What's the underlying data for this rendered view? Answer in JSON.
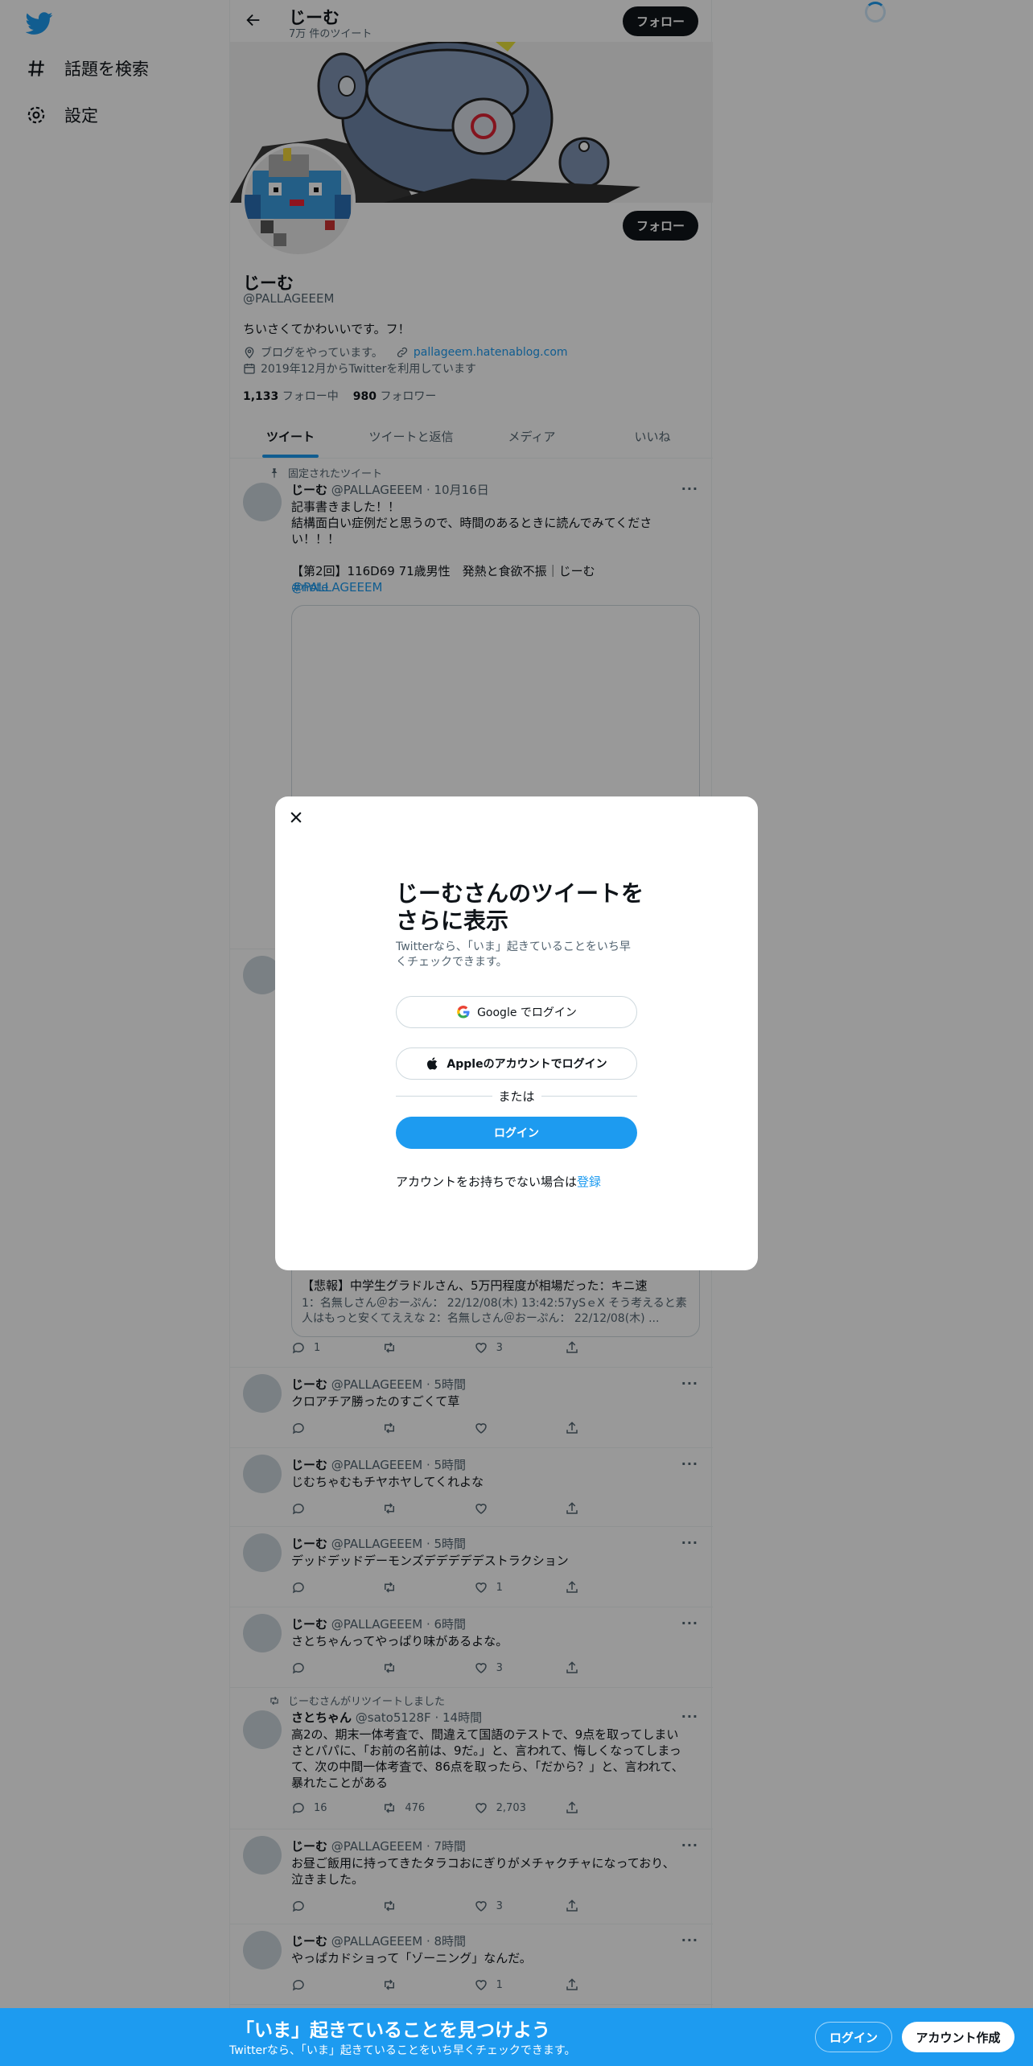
{
  "sidebar": {
    "items": [
      {
        "label": "話題を検索",
        "icon": "hashtag-icon"
      },
      {
        "label": "設定",
        "icon": "gear-icon"
      }
    ]
  },
  "header": {
    "name": "じーむ",
    "tweet_count": "7万 件のツイート",
    "follow_label": "フォロー"
  },
  "profile": {
    "name": "じーむ",
    "handle": "@PALLAGEEEM",
    "follow_label": "フォロー",
    "bio": "ちいさくてかわいいです。フ！",
    "location": "ブログをやっています。",
    "url": "pallageem.hatenablog.com",
    "joined": "2019年12月からTwitterを利用しています",
    "following_count": "1,133",
    "following_label": "フォロー中",
    "followers_count": "980",
    "followers_label": "フォロワー"
  },
  "tabs": [
    "ツイート",
    "ツイートと返信",
    "メディア",
    "いいね"
  ],
  "tweets": {
    "pinned": {
      "context": "固定されたツイート",
      "name": "じーむ",
      "handle": "@PALLAGEEEM",
      "time": "10月16日",
      "text": "記事書きました！！\n結構面白い症例だと思うので、時間のあるときに読んでみてください！！！",
      "text2": "【第2回】116D69 71歳男性　発熱と食欲不振｜じーむ ",
      "mention": "@PALLAGEEEM",
      "hashtag": "#note"
    },
    "card_tweet": {
      "card_title": "【悲報】中学生グラドルさん、5万円程度が相場だった：キニ速",
      "card_desc": "1：名無しさん＠おーぷん： 22/12/08(木) 13:42:57ySｅX そう考えると素人はもっと安くてええな 2：名無しさん＠おーぷん： 22/12/08(木) ...",
      "replies": "1",
      "retweets": "",
      "likes": "3"
    },
    "list": [
      {
        "name": "じーむ",
        "handle": "@PALLAGEEEM",
        "time": "5時間",
        "text": "クロアチア勝ったのすごくて草",
        "replies": "",
        "retweets": "",
        "likes": ""
      },
      {
        "name": "じーむ",
        "handle": "@PALLAGEEEM",
        "time": "5時間",
        "text": "じむちゃむもチヤホヤしてくれよな",
        "replies": "",
        "retweets": "",
        "likes": ""
      },
      {
        "name": "じーむ",
        "handle": "@PALLAGEEEM",
        "time": "5時間",
        "text": "デッドデッドデーモンズデデデデデストラクション",
        "replies": "",
        "retweets": "",
        "likes": "1"
      },
      {
        "name": "じーむ",
        "handle": "@PALLAGEEEM",
        "time": "6時間",
        "text": "さとちゃんってやっぱり味があるよな。",
        "replies": "",
        "retweets": "",
        "likes": "3"
      }
    ],
    "retweet": {
      "context": "じーむさんがリツイートしました",
      "name": "さとちゃん",
      "handle": "@sato5128F",
      "time": "14時間",
      "text": "高2の、期末一体考査で、間違えて国語のテストで、9点を取ってしまいさとパパに、「お前の名前は、9だ。」と、言われて、悔しくなってしまって、次の中間一体考査で、86点を取ったら、「だから？」と、言われて、暴れたことがある",
      "replies": "16",
      "retweets": "476",
      "likes": "2,703"
    },
    "list2": [
      {
        "name": "じーむ",
        "handle": "@PALLAGEEEM",
        "time": "7時間",
        "text": "お昼ご飯用に持ってきたタラコおにぎりがメチャクチャになっており、泣きました。",
        "replies": "",
        "retweets": "",
        "likes": "3"
      },
      {
        "name": "じーむ",
        "handle": "@PALLAGEEEM",
        "time": "8時間",
        "text": "やっぱカドショって「ゾーニング」なんだ。",
        "replies": "",
        "retweets": "",
        "likes": "1"
      }
    ]
  },
  "modal": {
    "title": "じーむさんのツイートをさらに表示",
    "subtitle": "Twitterなら、「いま」起きていることをいち早くチェックできます。",
    "google_label": "Google でログイン",
    "apple_label": "Appleのアカウントでログイン",
    "or_label": "または",
    "login_label": "ログイン",
    "signup_prompt": "アカウントをお持ちでない場合は",
    "signup_link": "登録"
  },
  "bottom_bar": {
    "title": "「いま」起きていることを見つけよう",
    "subtitle": "Twitterなら、「いま」起きていることをいち早くチェックできます。",
    "login_label": "ログイン",
    "signup_label": "アカウント作成"
  },
  "colors": {
    "accent": "#1d9bf0",
    "overlay": "rgba(0,0,0,0.4)"
  }
}
